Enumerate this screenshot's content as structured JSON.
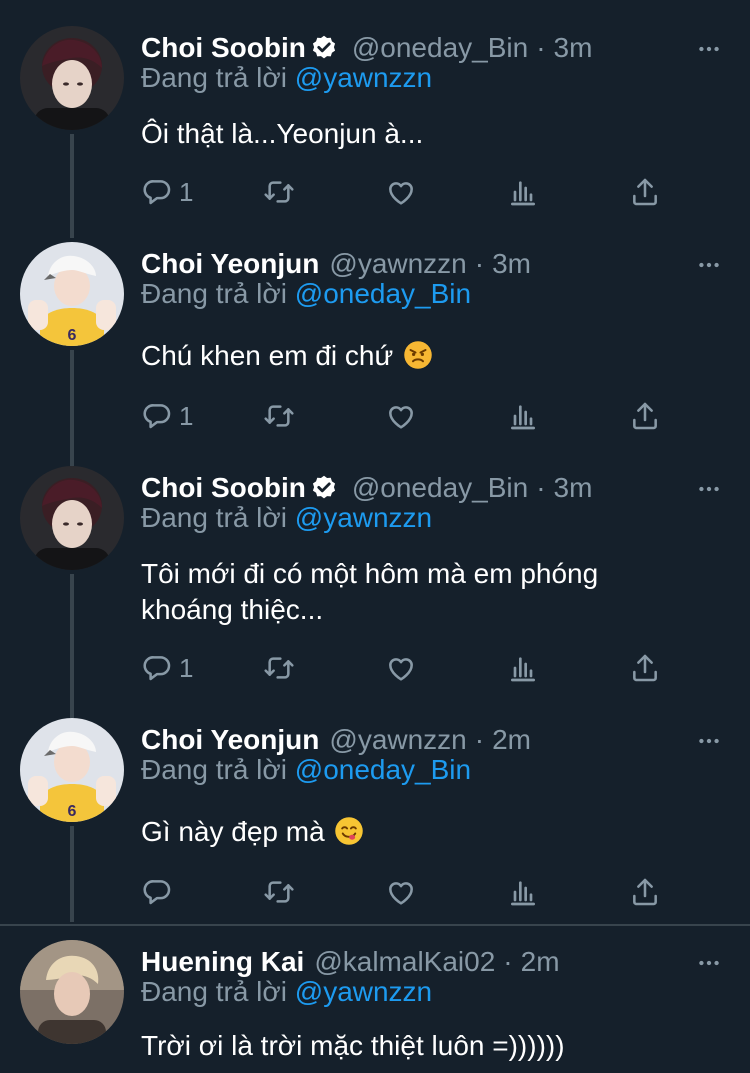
{
  "tweets": [
    {
      "name": "Choi Soobin",
      "verified": true,
      "handle": "@oneday_Bin",
      "time": "3m",
      "reply_prefix": "Đang trả lời",
      "reply_to": "@yawnzzn",
      "text": "Ôi thật là...Yeonjun à...",
      "emoji": "",
      "reply_count": "1"
    },
    {
      "name": "Choi Yeonjun",
      "verified": false,
      "handle": "@yawnzzn",
      "time": "3m",
      "reply_prefix": "Đang trả lời",
      "reply_to": "@oneday_Bin",
      "text": "Chú khen em đi chứ",
      "emoji": "angry-face-emoji",
      "reply_count": "1"
    },
    {
      "name": "Choi Soobin",
      "verified": true,
      "handle": "@oneday_Bin",
      "time": "3m",
      "reply_prefix": "Đang trả lời",
      "reply_to": "@yawnzzn",
      "text": "Tôi mới đi có một hôm mà em phóng khoáng thiệc...",
      "emoji": "",
      "reply_count": "1"
    },
    {
      "name": "Choi Yeonjun",
      "verified": false,
      "handle": "@yawnzzn",
      "time": "2m",
      "reply_prefix": "Đang trả lời",
      "reply_to": "@oneday_Bin",
      "text": "Gì này đẹp mà",
      "emoji": "yum-face-emoji",
      "reply_count": ""
    },
    {
      "name": "Huening Kai",
      "verified": false,
      "handle": "@kalmalKai02",
      "time": "2m",
      "reply_prefix": "Đang trả lời",
      "reply_to": "@yawnzzn",
      "text": "Trời ơi là trời mặc thiệt luôn =))))))",
      "emoji": "",
      "reply_count": ""
    }
  ],
  "separator": "·",
  "colors": {
    "background": "#15202b",
    "secondary_text": "#8899a6",
    "link": "#1d9bf0",
    "thread_line": "#38444d"
  },
  "icons": [
    "reply-icon",
    "retweet-icon",
    "like-icon",
    "analytics-icon",
    "share-icon",
    "more-icon",
    "verified-badge-icon"
  ]
}
